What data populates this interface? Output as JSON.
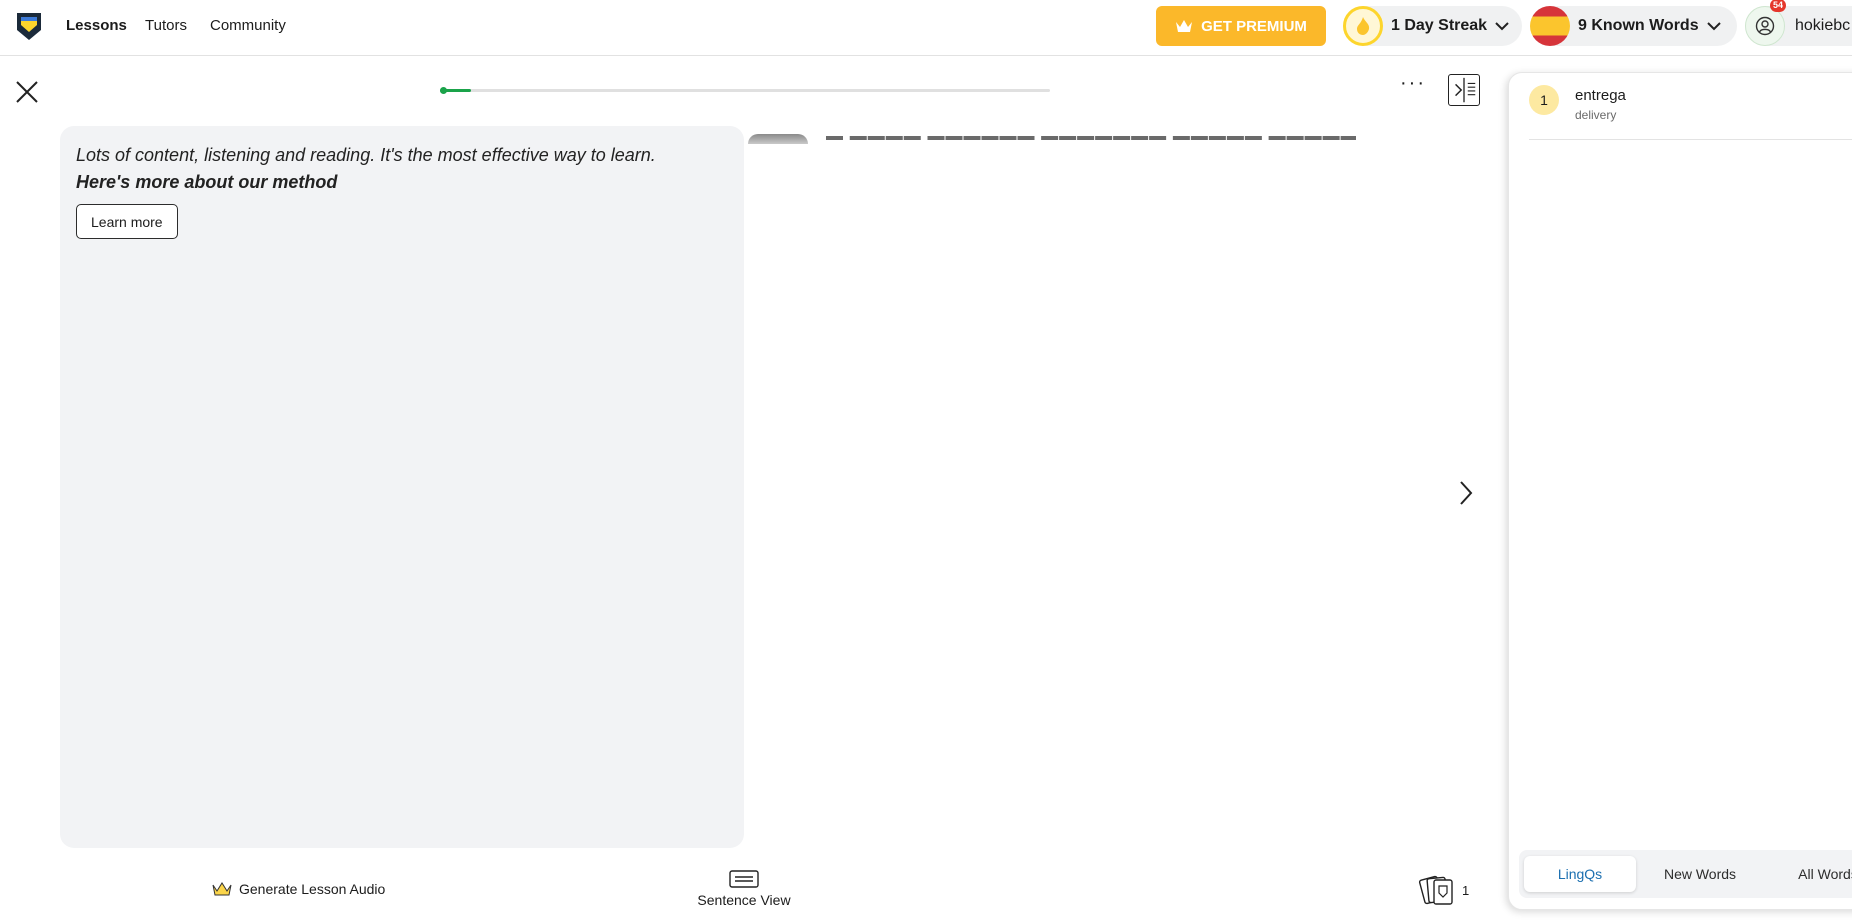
{
  "nav": {
    "links": [
      "Lessons",
      "Tutors",
      "Community"
    ],
    "premium_label": "GET PREMIUM",
    "streak_label": "1 Day Streak",
    "known_words_label": "9 Known Words",
    "notification_count": "54",
    "username": "hokiebc"
  },
  "lesson": {
    "progress_fraction": 0.05,
    "method_text": "Lots of content, listening and reading. It's the most effective way to learn.",
    "method_link": "Here's more about our method",
    "learn_more_label": "Learn more"
  },
  "toolbar": {
    "generate_audio_label": "Generate Lesson Audio",
    "sentence_view_label": "Sentence View",
    "lingq_count": "1"
  },
  "panel": {
    "lingqs": [
      {
        "number": "1",
        "term": "entrega",
        "hint": "delivery"
      }
    ],
    "tabs": [
      "LingQs",
      "New Words",
      "All Words"
    ],
    "active_tab": "LingQs"
  },
  "colors": {
    "premium": "#fbb82a",
    "progress": "#1aa34a",
    "lingq_badge": "#fde9a1",
    "active_tab_text": "#1b6fb0"
  }
}
